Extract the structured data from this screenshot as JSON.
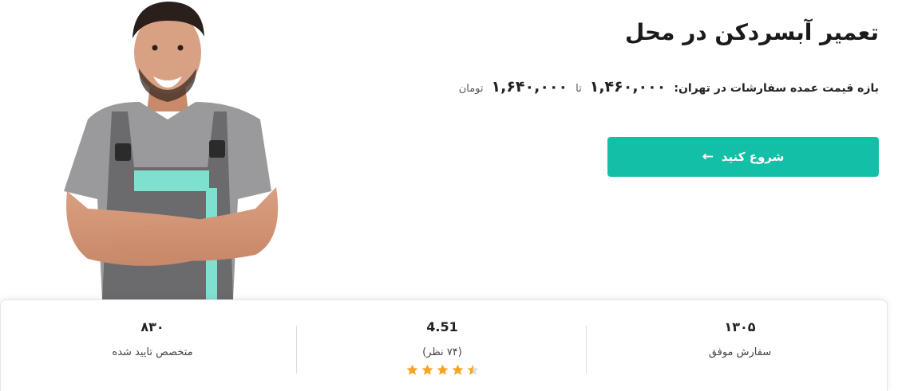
{
  "hero": {
    "title": "تعمیر آبسردکن در محل",
    "price_label": "بازه قیمت عمده سفارشات در تهران:",
    "price_min": "۱,۴۶۰,۰۰۰",
    "price_separator": "تا",
    "price_max": "۱,۶۴۰,۰۰۰",
    "price_unit": "تومان",
    "cta_label": "شروع کنید",
    "cta_color": "#13bfa6",
    "image_icon": "technician-photo"
  },
  "stats": [
    {
      "value": "۱۳۰۵",
      "label": "سفارش موفق"
    },
    {
      "value": "4.51",
      "label": "(۷۴ نظر)",
      "rating": 4.51,
      "rating_max": 5
    },
    {
      "value": "۸۳۰",
      "label": "متخصص تایید شده"
    }
  ],
  "colors": {
    "star": "#f5a623",
    "star_empty": "#dddddd",
    "accent": "#13bfa6"
  }
}
